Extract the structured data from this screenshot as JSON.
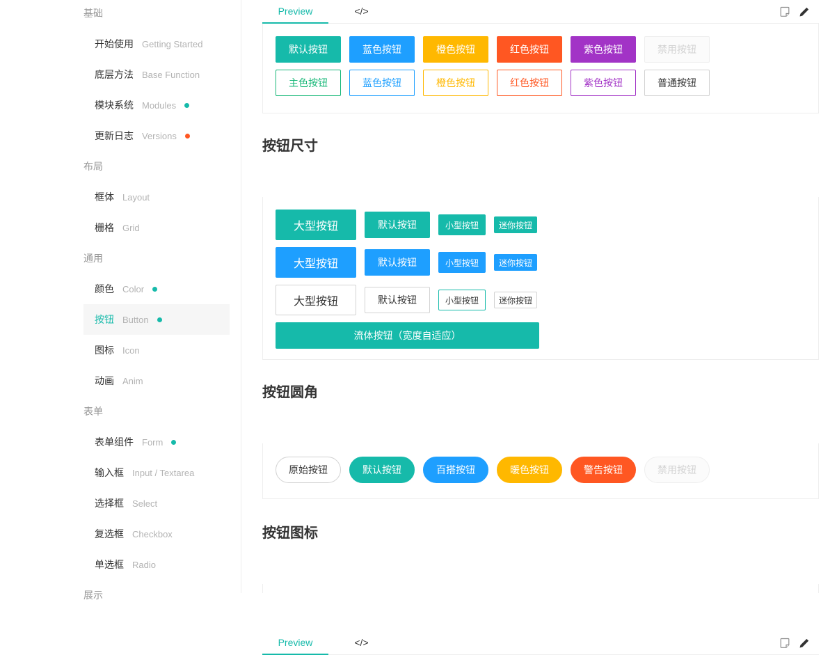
{
  "colors": {
    "accent_teal": "#16baaa",
    "green": "#16b777",
    "blue": "#1e9fff",
    "orange": "#ffb800",
    "red": "#ff5722",
    "purple": "#a233c6",
    "disabled_text": "#d2d2d2",
    "border": "#eee"
  },
  "tabs": {
    "preview": "Preview",
    "code": "</>"
  },
  "tab_icons": [
    {
      "name": "copy-icon"
    },
    {
      "name": "edit-icon"
    }
  ],
  "sidebar": {
    "sections": [
      {
        "title": "基础",
        "items": [
          {
            "zh": "开始使用",
            "en": "Getting Started",
            "dot": null,
            "active": false,
            "slug": "getting-started"
          },
          {
            "zh": "底层方法",
            "en": "Base Function",
            "dot": null,
            "active": false,
            "slug": "base-function"
          },
          {
            "zh": "模块系统",
            "en": "Modules",
            "dot": "teal",
            "active": false,
            "slug": "modules"
          },
          {
            "zh": "更新日志",
            "en": "Versions",
            "dot": "red",
            "active": false,
            "slug": "versions"
          }
        ]
      },
      {
        "title": "布局",
        "items": [
          {
            "zh": "框体",
            "en": "Layout",
            "dot": null,
            "active": false,
            "slug": "layout"
          },
          {
            "zh": "栅格",
            "en": "Grid",
            "dot": null,
            "active": false,
            "slug": "grid"
          }
        ]
      },
      {
        "title": "通用",
        "items": [
          {
            "zh": "颜色",
            "en": "Color",
            "dot": "teal",
            "active": false,
            "slug": "color"
          },
          {
            "zh": "按钮",
            "en": "Button",
            "dot": "teal",
            "active": true,
            "slug": "button"
          },
          {
            "zh": "图标",
            "en": "Icon",
            "dot": null,
            "active": false,
            "slug": "icon"
          },
          {
            "zh": "动画",
            "en": "Anim",
            "dot": null,
            "active": false,
            "slug": "anim"
          }
        ]
      },
      {
        "title": "表单",
        "items": [
          {
            "zh": "表单组件",
            "en": "Form",
            "dot": "teal",
            "active": false,
            "slug": "form"
          },
          {
            "zh": "输入框",
            "en": "Input / Textarea",
            "dot": null,
            "active": false,
            "slug": "input-textarea"
          },
          {
            "zh": "选择框",
            "en": "Select",
            "dot": null,
            "active": false,
            "slug": "select"
          },
          {
            "zh": "复选框",
            "en": "Checkbox",
            "dot": null,
            "active": false,
            "slug": "checkbox"
          },
          {
            "zh": "单选框",
            "en": "Radio",
            "dot": null,
            "active": false,
            "slug": "radio"
          }
        ]
      },
      {
        "title": "展示",
        "items": []
      }
    ]
  },
  "sections": [
    {
      "heading": "",
      "rows": [
        {
          "buttons": [
            {
              "label": "默认按钮",
              "variant": "fill-teal"
            },
            {
              "label": "蓝色按钮",
              "variant": "fill-blue"
            },
            {
              "label": "橙色按钮",
              "variant": "fill-orange"
            },
            {
              "label": "红色按钮",
              "variant": "fill-red"
            },
            {
              "label": "紫色按钮",
              "variant": "fill-purple"
            },
            {
              "label": "禁用按钮",
              "variant": "disabled"
            }
          ]
        },
        {
          "buttons": [
            {
              "label": "主色按钮",
              "variant": "outline-green"
            },
            {
              "label": "蓝色按钮",
              "variant": "outline-blue"
            },
            {
              "label": "橙色按钮",
              "variant": "outline-orange"
            },
            {
              "label": "红色按钮",
              "variant": "outline-red"
            },
            {
              "label": "紫色按钮",
              "variant": "outline-purple"
            },
            {
              "label": "普通按钮",
              "variant": "primary"
            }
          ]
        }
      ]
    },
    {
      "heading": "按钮尺寸",
      "rows": [
        {
          "tall": true,
          "buttons": [
            {
              "label": "大型按钮",
              "variant": "fill-teal",
              "size": "lg"
            },
            {
              "label": "默认按钮",
              "variant": "fill-teal"
            },
            {
              "label": "小型按钮",
              "variant": "fill-teal",
              "size": "sm"
            },
            {
              "label": "迷你按钮",
              "variant": "fill-teal",
              "size": "xs"
            }
          ]
        },
        {
          "tall": true,
          "buttons": [
            {
              "label": "大型按钮",
              "variant": "fill-blue",
              "size": "lg"
            },
            {
              "label": "默认按钮",
              "variant": "fill-blue"
            },
            {
              "label": "小型按钮",
              "variant": "fill-blue",
              "size": "sm"
            },
            {
              "label": "迷你按钮",
              "variant": "fill-blue",
              "size": "xs"
            }
          ]
        },
        {
          "tall": true,
          "buttons": [
            {
              "label": "大型按钮",
              "variant": "primary",
              "size": "lg"
            },
            {
              "label": "默认按钮",
              "variant": "primary"
            },
            {
              "label": "小型按钮",
              "variant": "primary-teal",
              "size": "sm"
            },
            {
              "label": "迷你按钮",
              "variant": "primary",
              "size": "xs"
            }
          ]
        },
        {
          "buttons": [
            {
              "label": "流体按钮（宽度自适应）",
              "variant": "fill-teal",
              "fluid": true
            }
          ]
        }
      ]
    },
    {
      "heading": "按钮圆角",
      "rows": [
        {
          "buttons": [
            {
              "label": "原始按钮",
              "variant": "primary",
              "pill": true
            },
            {
              "label": "默认按钮",
              "variant": "fill-teal",
              "pill": true
            },
            {
              "label": "百搭按钮",
              "variant": "fill-blue",
              "pill": true
            },
            {
              "label": "暖色按钮",
              "variant": "fill-orange",
              "pill": true
            },
            {
              "label": "警告按钮",
              "variant": "fill-red",
              "pill": true
            },
            {
              "label": "禁用按钮",
              "variant": "disabled",
              "pill": true
            }
          ]
        }
      ]
    },
    {
      "heading": "按钮图标",
      "rows": []
    }
  ]
}
